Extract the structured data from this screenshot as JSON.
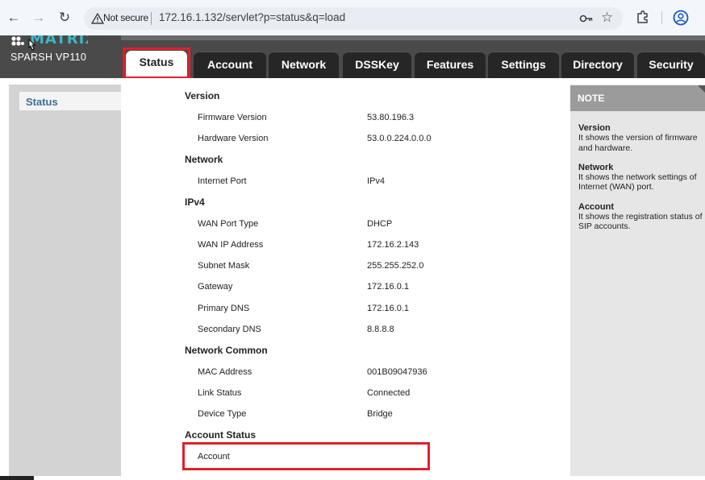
{
  "browser": {
    "not_secure": "Not secure",
    "url": "172.16.1.132/servlet?p=status&q=load"
  },
  "header": {
    "logo_text": "MATRIX",
    "model": "SPARSH VP110"
  },
  "tabs": [
    {
      "label": "Status",
      "active": true
    },
    {
      "label": "Account"
    },
    {
      "label": "Network"
    },
    {
      "label": "DSSKey"
    },
    {
      "label": "Features"
    },
    {
      "label": "Settings"
    },
    {
      "label": "Directory"
    },
    {
      "label": "Security"
    }
  ],
  "sidebar": {
    "items": [
      {
        "label": "Status"
      }
    ]
  },
  "status": {
    "version": {
      "title": "Version",
      "rows": [
        {
          "label": "Firmware Version",
          "value": "53.80.196.3"
        },
        {
          "label": "Hardware Version",
          "value": "53.0.0.224.0.0.0"
        }
      ]
    },
    "network": {
      "title": "Network",
      "rows": [
        {
          "label": "Internet Port",
          "value": "IPv4"
        }
      ]
    },
    "ipv4": {
      "title": "IPv4",
      "rows": [
        {
          "label": "WAN Port Type",
          "value": "DHCP"
        },
        {
          "label": "WAN IP Address",
          "value": "172.16.2.143"
        },
        {
          "label": "Subnet Mask",
          "value": "255.255.252.0"
        },
        {
          "label": "Gateway",
          "value": "172.16.0.1"
        },
        {
          "label": "Primary DNS",
          "value": "172.16.0.1"
        },
        {
          "label": "Secondary DNS",
          "value": "8.8.8.8"
        }
      ]
    },
    "network_common": {
      "title": "Network Common",
      "rows": [
        {
          "label": "MAC Address",
          "value": "001B09047936"
        },
        {
          "label": "Link Status",
          "value": "Connected"
        },
        {
          "label": "Device Type",
          "value": "Bridge"
        }
      ]
    },
    "account_status": {
      "title": "Account Status",
      "rows": [
        {
          "label": "Account",
          "value": ""
        }
      ]
    }
  },
  "note": {
    "title": "NOTE",
    "items": [
      {
        "heading": "Version",
        "text": "It shows the version of firmware and hardware."
      },
      {
        "heading": "Network",
        "text": "It shows the network settings of Internet (WAN) port."
      },
      {
        "heading": "Account",
        "text": "It shows the registration status of SIP accounts."
      }
    ]
  },
  "colors": {
    "highlight": "#e0202a",
    "header_bg": "#4a4a4a",
    "tab_bg": "#262626",
    "logo": "#3fb7c4",
    "sidebar_link": "#3b6d9a"
  }
}
